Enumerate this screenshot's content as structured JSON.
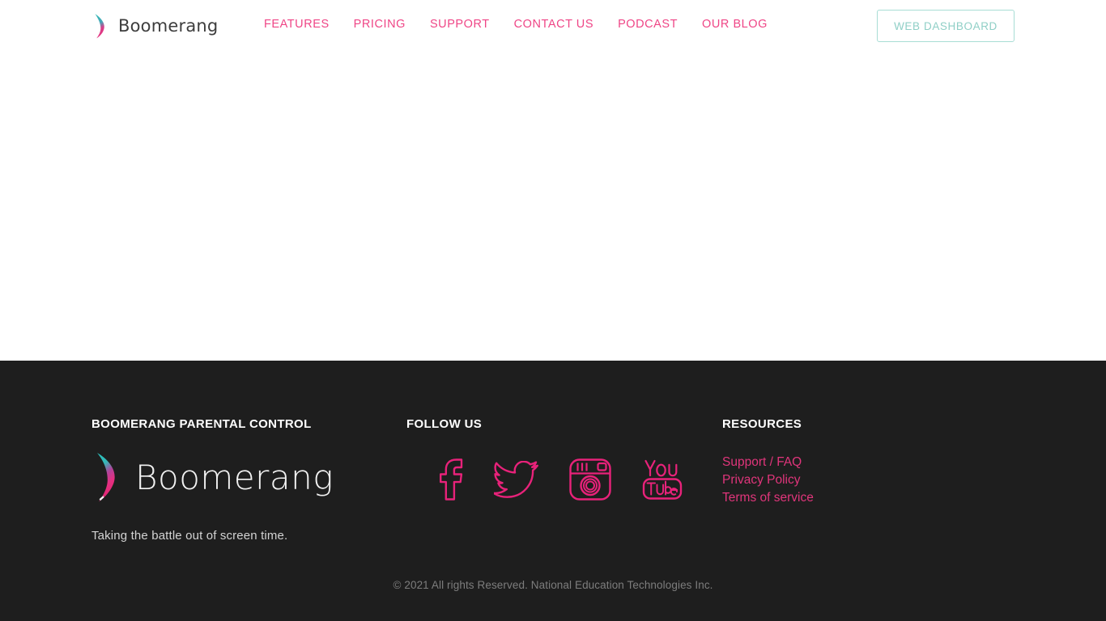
{
  "header": {
    "logo": {
      "name": "boomerang-logo",
      "wordmark": "Boomerang"
    },
    "nav": [
      {
        "label": "FEATURES"
      },
      {
        "label": "PRICING"
      },
      {
        "label": "SUPPORT"
      },
      {
        "label": "CONTACT US"
      },
      {
        "label": "PODCAST"
      },
      {
        "label": "OUR BLOG"
      }
    ],
    "cta": {
      "label": "WEB DASHBOARD"
    }
  },
  "footer": {
    "columns": {
      "brand": {
        "heading": "BOOMERANG PARENTAL CONTROL",
        "wordmark": "Boomerang",
        "tagline": "Taking the battle out of screen time."
      },
      "follow": {
        "heading": "FOLLOW US",
        "socials": [
          {
            "name": "facebook-icon",
            "label": "Facebook"
          },
          {
            "name": "twitter-icon",
            "label": "Twitter"
          },
          {
            "name": "instagram-icon",
            "label": "Instagram"
          },
          {
            "name": "youtube-icon",
            "label": "YouTube"
          }
        ]
      },
      "resources": {
        "heading": "RESOURCES",
        "links": [
          {
            "label": "Support / FAQ"
          },
          {
            "label": "Privacy Policy"
          },
          {
            "label": "Terms of service"
          }
        ]
      }
    },
    "copyright": "© 2021 All rights Reserved. National Education Technologies Inc."
  },
  "colors": {
    "pink": "#ef4586",
    "pink_deep": "#e0357b",
    "teal": "#3cb9b0",
    "mint": "#a8ddd5",
    "footer_bg": "#1e1e1e",
    "page_bg": "#ffffff"
  }
}
